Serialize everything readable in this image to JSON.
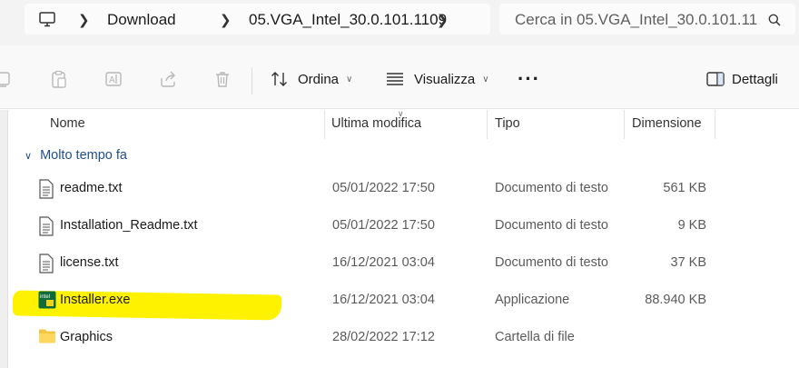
{
  "address_bar": {
    "icon": "computer-icon",
    "crumbs": [
      "Download",
      "05.VGA_Intel_30.0.101.1109"
    ]
  },
  "search": {
    "placeholder": "Cerca in 05.VGA_Intel_30.0.101.11",
    "icon": "search-icon"
  },
  "toolbar": {
    "sort_label": "Ordina",
    "view_label": "Visualizza",
    "details_label": "Dettagli",
    "icons": [
      "copy-icon",
      "paste-icon",
      "rename-icon",
      "share-icon",
      "delete-icon",
      "sort-icon",
      "view-icon",
      "more-icon",
      "details-pane-icon"
    ]
  },
  "columns": {
    "name": "Nome",
    "modified": "Ultima modifica",
    "type": "Tipo",
    "size": "Dimensione"
  },
  "group": {
    "label": "Molto tempo fa"
  },
  "files": [
    {
      "name": "readme.txt",
      "modified": "05/01/2022 17:50",
      "type": "Documento di testo",
      "size": "561 KB",
      "icon": "text-file-icon"
    },
    {
      "name": "Installation_Readme.txt",
      "modified": "05/01/2022 17:50",
      "type": "Documento di testo",
      "size": "9 KB",
      "icon": "text-file-icon"
    },
    {
      "name": "license.txt",
      "modified": "16/12/2021 03:04",
      "type": "Documento di testo",
      "size": "37 KB",
      "icon": "text-file-icon"
    },
    {
      "name": "Installer.exe",
      "modified": "16/12/2021 03:04",
      "type": "Applicazione",
      "size": "88.940 KB",
      "icon": "intel-installer-icon",
      "highlighted": true
    },
    {
      "name": "Graphics",
      "modified": "28/02/2022 17:12",
      "type": "Cartella di file",
      "size": "",
      "icon": "folder-icon"
    }
  ],
  "colors": {
    "highlight": "#fff200",
    "group_text": "#1f4e8f",
    "folder": "#f4c542"
  }
}
